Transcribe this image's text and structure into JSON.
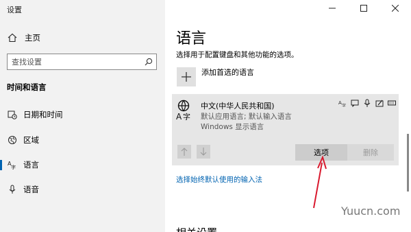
{
  "window": {
    "title": "设置"
  },
  "sidebar": {
    "home_label": "主页",
    "search_placeholder": "查找设置",
    "section_title": "时间和语言",
    "items": [
      {
        "label": "日期和时间",
        "icon": "calendar-clock-icon"
      },
      {
        "label": "区域",
        "icon": "globe-region-icon"
      },
      {
        "label": "语言",
        "icon": "language-icon",
        "active": true
      },
      {
        "label": "语音",
        "icon": "microphone-icon"
      }
    ]
  },
  "main": {
    "title": "语言",
    "description": "选择用于配置键盘和其他功能的选项。",
    "add_language_label": "添加首选的语言",
    "language_card": {
      "name": "中文(中华人民共和国)",
      "sub1": "默认应用语言; 默认输入语言",
      "sub2": "Windows 显示语言",
      "options_label": "选项",
      "remove_label": "删除"
    },
    "link_label": "选择始终默认使用的输入法",
    "related_label": "相关设置"
  },
  "watermark": "Yuucn.com",
  "colors": {
    "accent": "#0063b1",
    "sidebar_bg": "#f2f2f2",
    "card_bg": "#e6e6e6",
    "annotation": "#d9182d"
  }
}
